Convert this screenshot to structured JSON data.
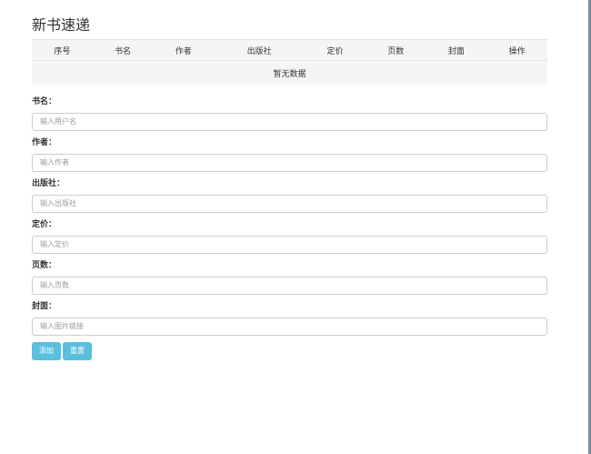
{
  "page": {
    "title": "新书速递"
  },
  "table": {
    "headers": [
      "序号",
      "书名",
      "作者",
      "出版社",
      "定价",
      "页数",
      "封面",
      "操作"
    ],
    "empty_text": "暂无数据"
  },
  "form": {
    "fields": [
      {
        "label": "书名：",
        "placeholder": "输入用户名"
      },
      {
        "label": "作者：",
        "placeholder": "输入作者"
      },
      {
        "label": "出版社：",
        "placeholder": "输入出版社"
      },
      {
        "label": "定价：",
        "placeholder": "输入定价"
      },
      {
        "label": "页数：",
        "placeholder": "输入页数"
      },
      {
        "label": "封面：",
        "placeholder": "输入图片链接"
      }
    ],
    "add_label": "添加",
    "reset_label": "重置"
  },
  "colors": {
    "button": "#5bc0de",
    "table_bg": "#f5f5f5",
    "scrollbar": "#7b8aa0"
  }
}
